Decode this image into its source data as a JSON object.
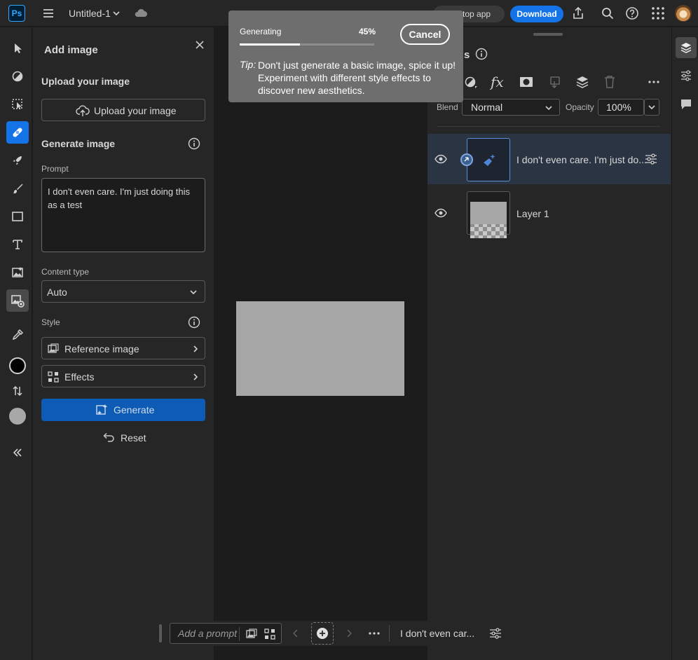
{
  "app": {
    "logo": "Ps",
    "doc_title": "Untitled-1"
  },
  "topbar": {
    "desktop_label": "Desktop app",
    "desktop_visible": "sktop app",
    "download_label": "Download"
  },
  "add_image": {
    "title": "Add image",
    "upload_heading": "Upload your image",
    "upload_button": "Upload your image",
    "generate_heading": "Generate image",
    "prompt_label": "Prompt",
    "prompt_value": "I don't even care. I'm just doing this as a test",
    "content_type_label": "Content type",
    "content_type_value": "Auto",
    "style_label": "Style",
    "reference_image": "Reference image",
    "effects": "Effects",
    "generate_button": "Generate",
    "reset_button": "Reset"
  },
  "generating": {
    "label": "Generating",
    "percent_text": "45%",
    "progress": 0.45,
    "cancel": "Cancel",
    "tip_label": "Tip:",
    "tip_text": "Don't just generate a basic image, spice it up! Experiment with different style effects to discover new aesthetics."
  },
  "layers": {
    "title_visible": "s",
    "blend_label": "Blend",
    "blend_value": "Normal",
    "opacity_label": "Opacity",
    "opacity_value": "100%",
    "items": [
      {
        "name": "I don't even care. I'm just do...",
        "selected": true
      },
      {
        "name": "Layer 1",
        "selected": false
      }
    ]
  },
  "taskbar": {
    "prompt_placeholder": "Add a prompt",
    "layer_name": "I don't even car..."
  },
  "colors": {
    "accent": "#1473e6",
    "generate_bg": "#0d5bb5",
    "panel_bg": "#262626",
    "canvas_bg": "#1c1c1c"
  }
}
